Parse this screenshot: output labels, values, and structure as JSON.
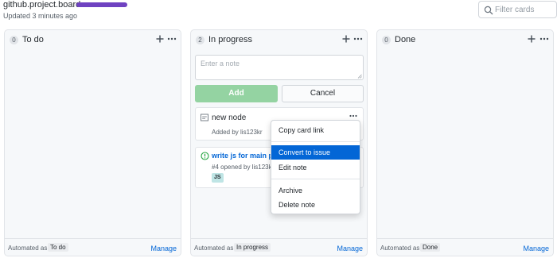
{
  "header": {
    "title": "github.project.board",
    "updated": "Updated 3 minutes ago",
    "accent": "#6f42c1"
  },
  "filter": {
    "placeholder": "Filter cards",
    "value": ""
  },
  "columns": [
    {
      "count": "0",
      "name": "To do",
      "automated_label": "Automated as",
      "automated_value": "To do",
      "manage": "Manage"
    },
    {
      "count": "2",
      "name": "In progress",
      "automated_label": "Automated as",
      "automated_value": "In progress",
      "manage": "Manage",
      "note_form": {
        "placeholder": "Enter a note",
        "add_label": "Add",
        "cancel_label": "Cancel"
      },
      "cards": {
        "note": {
          "title": "new node",
          "added_by": "Added by lis123kr"
        },
        "issue": {
          "title": "write js for main pa",
          "meta": "#4 opened by lis123k",
          "label": "JS",
          "label_color": "#bfe5e5"
        }
      }
    },
    {
      "count": "0",
      "name": "Done",
      "automated_label": "Automated as",
      "automated_value": "Done",
      "manage": "Manage"
    }
  ],
  "context_menu": {
    "items": [
      "Copy card link",
      "Convert to issue",
      "Edit note",
      "Archive",
      "Delete note"
    ],
    "active_index": 1,
    "active_color": "#0366d6"
  },
  "icons": {
    "search": "search-icon",
    "plus": "plus-icon",
    "more": "kebab-horizontal-icon",
    "note": "note-icon",
    "issue": "issue-opened-icon"
  }
}
